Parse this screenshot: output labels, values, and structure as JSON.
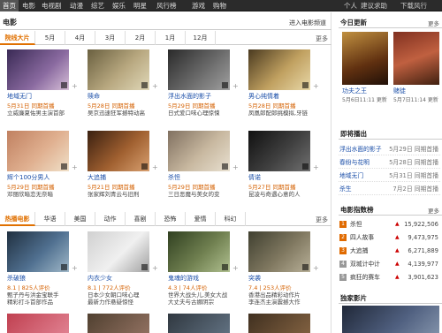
{
  "topnav": {
    "items": [
      "首页",
      "电影",
      "电视剧",
      "动漫",
      "综艺",
      "娱乐",
      "明星",
      "风行榜",
      "游戏",
      "购物"
    ],
    "right": [
      "个人",
      "建议求助",
      "下载风行"
    ]
  },
  "movies": {
    "title": "电影",
    "enter_link": "进入电影频道",
    "tabs": [
      "院线大片",
      "5月",
      "4月",
      "3月",
      "2月",
      "1月",
      "12月"
    ],
    "more": "更多",
    "cards": [
      {
        "title": "地域无门",
        "date": "5月31日",
        "label": "同期首播",
        "desc": "立威廉夏佑男主演首部"
      },
      {
        "title": "赎命",
        "date": "5月28日",
        "label": "同期首播",
        "desc": "吴京迅速狂军撼特动高"
      },
      {
        "title": "浮出水面的影子",
        "date": "5月29日",
        "label": "同期首播",
        "desc": "日式爱口味心理惊悚"
      },
      {
        "title": "男心纯情着",
        "date": "5月28日",
        "label": "同期首播",
        "desc": "凤凰郎配郎挑模拟,牙链"
      },
      {
        "title": "辉个100分男人",
        "date": "5月29日",
        "label": "同期首播",
        "desc": "邓丽欣暗恋无奈暗"
      },
      {
        "title": "大追捕",
        "date": "5月21日",
        "label": "同期首播",
        "desc": "张家辉刘青云与旧刑"
      },
      {
        "title": "杀怛",
        "date": "5月29日",
        "label": "同期首播",
        "desc": "三日恶魔与美女的变"
      },
      {
        "title": "倩诺",
        "date": "5月27日",
        "label": "同期首播",
        "desc": "昆凌与奇遇心意的人"
      }
    ]
  },
  "hot": {
    "tabs": [
      "热播电影",
      "华语",
      "美国",
      "动作",
      "喜剧",
      "恐怖",
      "爱情",
      "科幻"
    ],
    "more": "更多",
    "cards": [
      {
        "title": "杀破狼",
        "score": "8.1",
        "count": "825人评价",
        "desc1": "甄子丹与洪金宝联手",
        "desc2": "精彩打斗首部作品"
      },
      {
        "title": "内衣少女",
        "score": "8.1",
        "count": "772人评价",
        "desc1": "日本少女朝口味心理",
        "desc2": "最新力作悬疑惊怪"
      },
      {
        "title": "鬼魂的游戏",
        "score": "4.3",
        "count": "74人评价",
        "desc1": "世界大战头儿,美女大战",
        "desc2": "大丈夫与古娜阴宗"
      },
      {
        "title": "突袭",
        "score": "7.4",
        "count": "253人评价",
        "desc1": "香港出品精彩动作片",
        "desc2": "李连杰主演震撼大作"
      }
    ]
  },
  "sidebar": {
    "new_title": "今日更新",
    "more": "更多",
    "new_items": [
      {
        "name": "功夫之王",
        "date": "5月6日11:11 更新"
      },
      {
        "name": "赌徒",
        "date": "5月7日11:14 更新"
      }
    ],
    "soon_title": "即将播出",
    "soon": [
      {
        "name": "浮出水面的影子",
        "date": "5月29日 同期首播"
      },
      {
        "name": "春纷与花明",
        "date": "5月28日 同期首播"
      },
      {
        "name": "地域无门",
        "date": "5月31日 同期首播"
      },
      {
        "name": "杀生",
        "date": "7月2日 同期首播"
      }
    ],
    "rank_title": "电影指数榜",
    "ranks": [
      {
        "no": "1",
        "name": "杀怛",
        "value": "15,922,506"
      },
      {
        "no": "2",
        "name": "四人故事",
        "value": "9,473,975"
      },
      {
        "no": "3",
        "name": "大追捕",
        "value": "6,271,889"
      },
      {
        "no": "4",
        "name": "双城计中计",
        "value": "4,139,977"
      },
      {
        "no": "5",
        "name": "疯狂的赛车",
        "value": "3,901,623"
      }
    ],
    "exp_title": "独家影片"
  },
  "colors": {
    "accent": "#e07000",
    "link": "#1a4ea8",
    "nav": "#2b2b2b"
  }
}
